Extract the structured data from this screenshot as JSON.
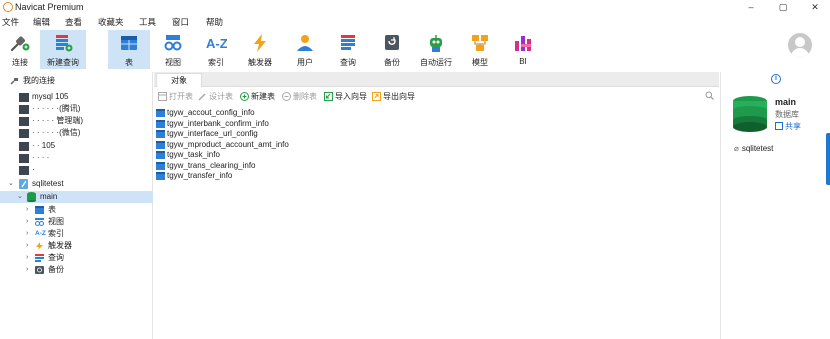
{
  "window": {
    "title": "Navicat Premium",
    "controls": [
      "–",
      "▢",
      "✕"
    ]
  },
  "menu": [
    "文件",
    "编辑",
    "查看",
    "收藏夹",
    "工具",
    "窗口",
    "帮助"
  ],
  "toolbar": {
    "connect": "连接",
    "new_query": "新建查询",
    "table": "表",
    "view": "视图",
    "index": "索引",
    "trigger": "触发器",
    "user": "用户",
    "query": "查询",
    "backup": "备份",
    "automation": "自动运行",
    "model": "模型",
    "bi": "BI"
  },
  "sidebar": {
    "header": "我的连接",
    "connections": [
      "mysql 105",
      "·  ·   ·  ·  ·  ·(腾讯)",
      "·   ·  ·  ·   ·  管理端)",
      "·  ·  ·  ·  ·  ·(微信)",
      "·   ·  105",
      "·  ·  ·  ·",
      "·"
    ],
    "db_connection": "sqlitetest",
    "schema": "main",
    "children": [
      "表",
      "视图",
      "索引",
      "触发器",
      "查询",
      "备份"
    ]
  },
  "main": {
    "tab": "对象",
    "actions": {
      "open": "打开表",
      "design": "设计表",
      "new": "新建表",
      "delete": "删除表",
      "import": "导入向导",
      "export": "导出向导"
    },
    "tables": [
      "tgyw_accout_config_info",
      "tgyw_interbank_confirm_info",
      "tgyw_interface_url_config",
      "tgyw_mproduct_account_amt_info",
      "tgyw_task_info",
      "tgyw_trans_clearing_info",
      "tgyw_transfer_info"
    ]
  },
  "info_panel": {
    "name": "main",
    "type": "数据库",
    "share": "共享",
    "file": "sqlitetest"
  },
  "colors": {
    "accent": "#1e6fd0",
    "selected": "#cfe3f7",
    "db_green": "#1f9a4c"
  }
}
